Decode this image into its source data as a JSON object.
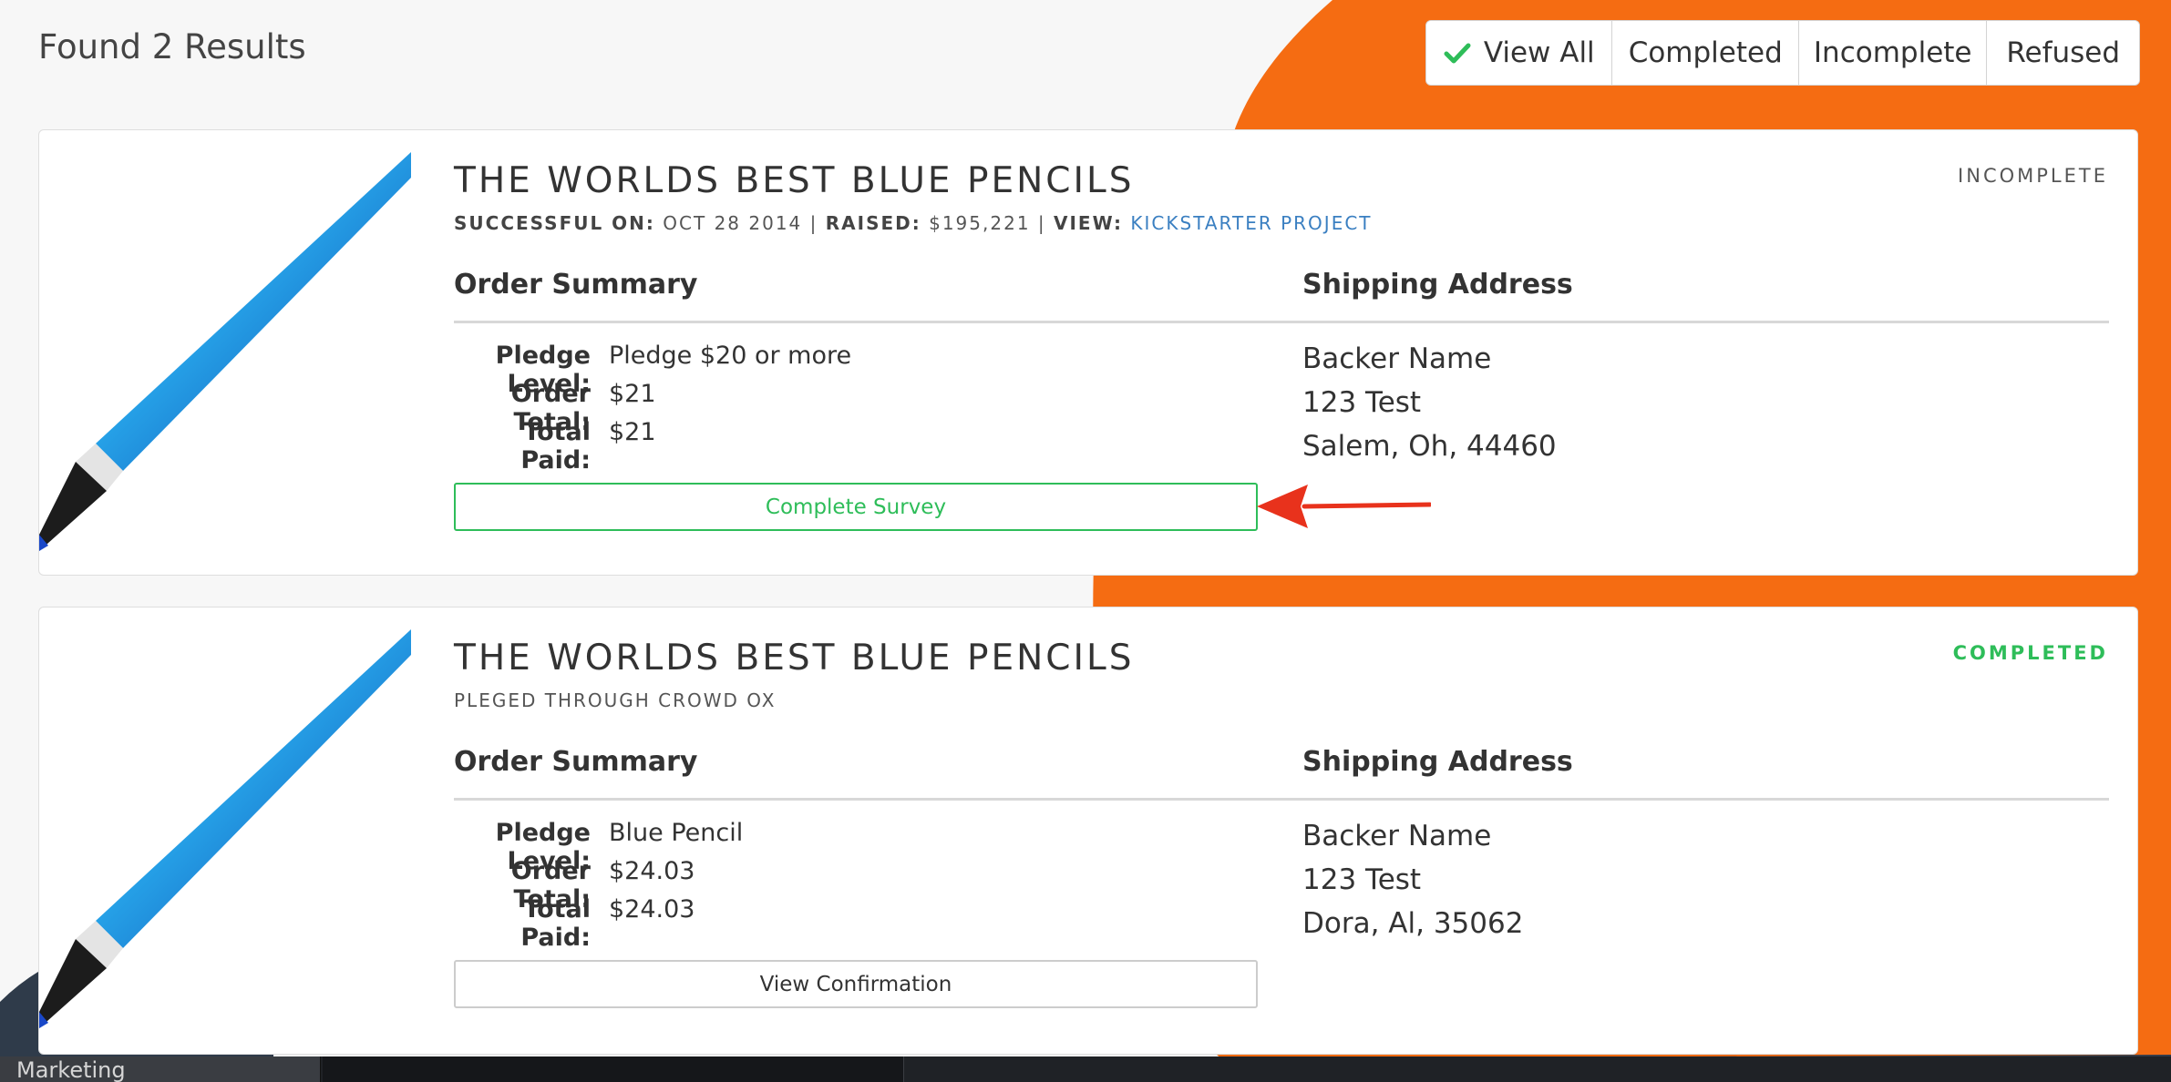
{
  "results": {
    "heading": "Found 2 Results"
  },
  "filters": [
    {
      "label": "View All",
      "icon": "check-icon",
      "selected": true
    },
    {
      "label": "Completed"
    },
    {
      "label": "Incomplete"
    },
    {
      "label": "Refused"
    }
  ],
  "colors": {
    "accent_orange": "#f56c12",
    "success_green": "#2ebd59",
    "link_blue": "#3a7fc1",
    "annotation_red": "#e8321c",
    "dark_navy": "#2f3b4a"
  },
  "orders": [
    {
      "title": "THE WORLDS BEST BLUE PENCILS",
      "meta": {
        "successful_label": "SUCCESSFUL ON:",
        "successful_value": "OCT 28 2014",
        "sep1": "|",
        "raised_label": "RAISED:",
        "raised_value": "$195,221",
        "sep2": "|",
        "view_label": "VIEW:",
        "view_link": "KICKSTARTER PROJECT"
      },
      "status": "INCOMPLETE",
      "order_summary_heading": "Order Summary",
      "shipping_heading": "Shipping Address",
      "pledge_label": "Pledge Level:",
      "pledge_value": "Pledge $20 or more",
      "order_total_label": "Order Total:",
      "order_total_value": "$21",
      "total_paid_label": "Total Paid:",
      "total_paid_value": "$21",
      "address": [
        "Backer Name",
        "123 Test",
        "Salem, Oh, 44460"
      ],
      "action_label": "Complete Survey"
    },
    {
      "title": "THE WORLDS BEST BLUE PENCILS",
      "subtitle": "PLEGED THROUGH CROWD OX",
      "status": "COMPLETED",
      "order_summary_heading": "Order Summary",
      "shipping_heading": "Shipping Address",
      "pledge_label": "Pledge Level:",
      "pledge_value": "Blue Pencil",
      "order_total_label": "Order Total:",
      "order_total_value": "$24.03",
      "total_paid_label": "Total Paid:",
      "total_paid_value": "$24.03",
      "address": [
        "Backer Name",
        "123 Test",
        "Dora, Al, 35062"
      ],
      "action_label": "View Confirmation"
    }
  ],
  "taskbar": {
    "item_label": "Marketing"
  }
}
